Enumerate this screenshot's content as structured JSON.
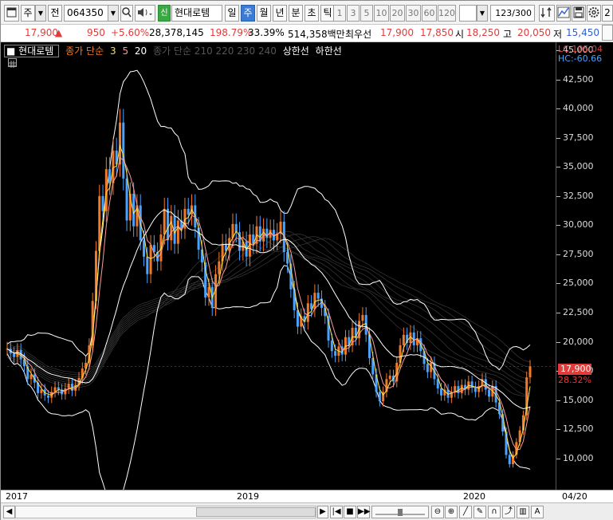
{
  "toolbar": {
    "market_label": "주",
    "type_label": "전",
    "code_value": "064350",
    "flag_label": "신",
    "stock_name": "현대로템",
    "period_tabs": [
      "일",
      "주",
      "월",
      "년",
      "분",
      "초",
      "틱"
    ],
    "selected_period": "주",
    "interval_buttons": [
      "1",
      "3",
      "5",
      "10",
      "20",
      "30",
      "60",
      "120"
    ],
    "count_value": "123",
    "count_total": "/300",
    "zoom_label": "2"
  },
  "quote": {
    "price": "17,900",
    "change_arrow": "▲",
    "change": "950",
    "change_pct": "+5.60%",
    "volume": "28,378,145",
    "volume_ratio": "198.79%",
    "turnover": "33.39%",
    "amount": "514,358백만",
    "priority_label": "최우선",
    "best_ask": "17,900",
    "best_bid": "17,850",
    "open_label": "시",
    "open": "18,250",
    "high_label": "고",
    "high": "20,050",
    "low_label": "저",
    "low": "15,450"
  },
  "legend": {
    "stock": "현대로템",
    "ma_label": "종가 단순",
    "ma_periods": [
      "3",
      "5",
      "20"
    ],
    "ma_long": "종가 단순 210  220  230  240",
    "upper_band": "상한선",
    "lower_band": "하한선"
  },
  "indicators": {
    "lc": "LC:105.04",
    "hc": "HC:-60.66",
    "current_price_tag": "17,900",
    "current_pct": "28.32%"
  },
  "x_axis": {
    "labels": [
      "2017",
      "2019",
      "2020"
    ],
    "right_label": "04/20"
  },
  "colors": {
    "up": "#e23b3b",
    "down": "#4aa3ff",
    "up_candle": "#f07a2a",
    "band": "#ffffff",
    "ma3": "#ffe24a",
    "ma5": "#ff9a9a",
    "ma20": "#ffffff"
  },
  "chart_data": {
    "type": "candlestick",
    "title": "현대로템",
    "ylim": [
      8000,
      45000
    ],
    "y_ticks": [
      10000,
      12500,
      15000,
      17500,
      20000,
      22500,
      25000,
      27500,
      30000,
      32500,
      35000,
      37500,
      40000,
      42500,
      45000
    ],
    "y_tick_labels": [
      "10,000",
      "12,500",
      "15,000",
      "17,500",
      "20,000",
      "22,500",
      "25,000",
      "27,500",
      "30,000",
      "32,500",
      "35,000",
      "37,500",
      "40,000",
      "42,500",
      "45,000"
    ],
    "series_names": [
      "현대로템",
      "3",
      "5",
      "20",
      "상한선",
      "하한선"
    ],
    "closes": [
      19400,
      19000,
      18700,
      19300,
      18500,
      17900,
      16800,
      17200,
      16500,
      15600,
      15900,
      15400,
      15200,
      15700,
      16100,
      15900,
      15500,
      16000,
      16400,
      15800,
      16300,
      16900,
      17700,
      18200,
      19700,
      23500,
      27800,
      32500,
      31200,
      34800,
      33600,
      36400,
      35200,
      38800,
      34000,
      30400,
      32700,
      29900,
      31700,
      28700,
      27300,
      25800,
      28300,
      27700,
      26900,
      29200,
      31400,
      28700,
      30800,
      28400,
      30400,
      29700,
      31400,
      30900,
      31700,
      29800,
      27900,
      26800,
      23800,
      24700,
      22900,
      25800,
      26900,
      28400,
      27800,
      28900,
      30100,
      29400,
      27800,
      28600,
      27300,
      29200,
      28400,
      29900,
      28600,
      29700,
      28900,
      29600,
      28700,
      29300,
      30300,
      27700,
      26700,
      24500,
      22700,
      21300,
      22200,
      21700,
      23300,
      22800,
      24200,
      23700,
      22900,
      22200,
      20100,
      19200,
      18800,
      19600,
      18900,
      20400,
      19700,
      21200,
      20300,
      21800,
      22300,
      20600,
      18600,
      17200,
      15700,
      14900,
      15700,
      16800,
      17100,
      16600,
      18200,
      19700,
      20600,
      19900,
      20800,
      19700,
      20300,
      19200,
      18100,
      17400,
      18200,
      16800,
      16000,
      15400,
      15900,
      15200,
      15700,
      16200,
      15600,
      16300,
      15900,
      16600,
      16100,
      15700,
      16200,
      16800,
      15900,
      15300,
      16200,
      14800,
      13800,
      12300,
      10300,
      9500,
      10300,
      11400,
      12400,
      13700,
      16950,
      17900
    ]
  }
}
